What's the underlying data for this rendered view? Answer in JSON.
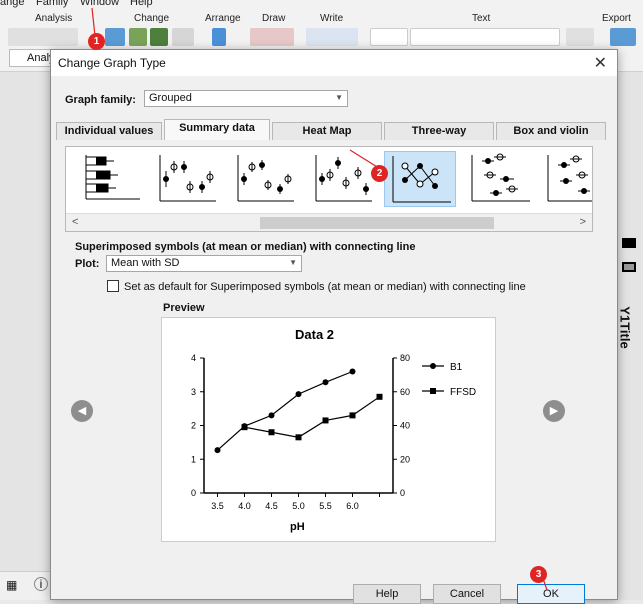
{
  "menu": {
    "items": [
      "ange",
      "Family",
      "Window",
      "Help"
    ]
  },
  "ribbon": {
    "groups": [
      "Analysis",
      "Change",
      "Arrange",
      "Draw",
      "Write",
      "Text",
      "Export"
    ],
    "analysis_label": "Analy"
  },
  "side": {
    "y1title": "Y1Title"
  },
  "dialog": {
    "title": "Change Graph Type",
    "close": "✕",
    "graph_family_label": "Graph family:",
    "graph_family_value": "Grouped",
    "tabs": [
      {
        "label": "Individual values"
      },
      {
        "label": "Summary data"
      },
      {
        "label": "Heat Map"
      },
      {
        "label": "Three-way"
      },
      {
        "label": "Box and violin"
      }
    ],
    "selected_description": "Superimposed symbols (at mean or median) with connecting line",
    "plot_label": "Plot:",
    "plot_value": "Mean with SD",
    "default_checkbox_label": "Set as default for Superimposed symbols (at mean or median) with connecting line",
    "preview_label": "Preview",
    "buttons": {
      "help": "Help",
      "cancel": "Cancel",
      "ok": "OK"
    }
  },
  "badges": [
    "1",
    "2",
    "3"
  ],
  "chart_data": {
    "type": "line",
    "title": "Data 2",
    "xlabel": "pH",
    "x_ticks": [
      "3.5",
      "4.0",
      "4.5",
      "5.0",
      "5.5",
      "6.0"
    ],
    "y_left_ticks": [
      "0",
      "1",
      "2",
      "3",
      "4"
    ],
    "y_right_ticks": [
      "0",
      "20",
      "40",
      "60",
      "80"
    ],
    "ylim_left": [
      0,
      4
    ],
    "ylim_right": [
      0,
      80
    ],
    "xlim": [
      3.25,
      6.75
    ],
    "series": [
      {
        "name": "B1",
        "axis": "left",
        "marker": "circle",
        "x": [
          3.5,
          4.0,
          4.5,
          5.0,
          5.5,
          6.0
        ],
        "y": [
          1.27,
          1.98,
          2.3,
          2.93,
          3.28,
          3.6
        ]
      },
      {
        "name": "FFSD",
        "axis": "right",
        "marker": "square",
        "x": [
          4.0,
          4.5,
          5.0,
          5.5,
          6.0,
          6.5
        ],
        "y": [
          39,
          36,
          33,
          43,
          46,
          57
        ]
      }
    ]
  }
}
